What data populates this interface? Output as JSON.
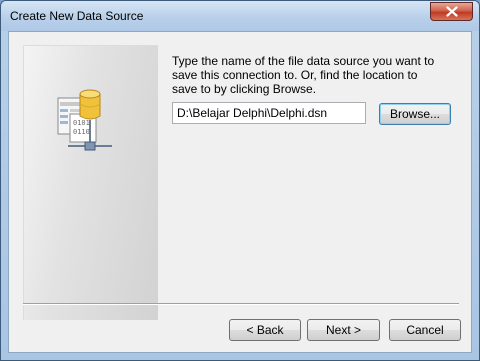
{
  "window": {
    "title": "Create New Data Source",
    "close_icon": "close-icon"
  },
  "wizard": {
    "illustration_icon": "data-source-file-icon",
    "instructions": "Type the name of the file data source you want to save this connection to.  Or, find the location to save to by clicking Browse.",
    "path_value": "D:\\Belajar Delphi\\Delphi.dsn",
    "browse_label": "Browse..."
  },
  "footer": {
    "back_label": "< Back",
    "next_label": "Next >",
    "cancel_label": "Cancel"
  },
  "colors": {
    "title_bar": "#b9d0ea",
    "close_button": "#c13a22",
    "dialog_face": "#f0f0f0",
    "default_button_border": "#3c7fb1"
  }
}
